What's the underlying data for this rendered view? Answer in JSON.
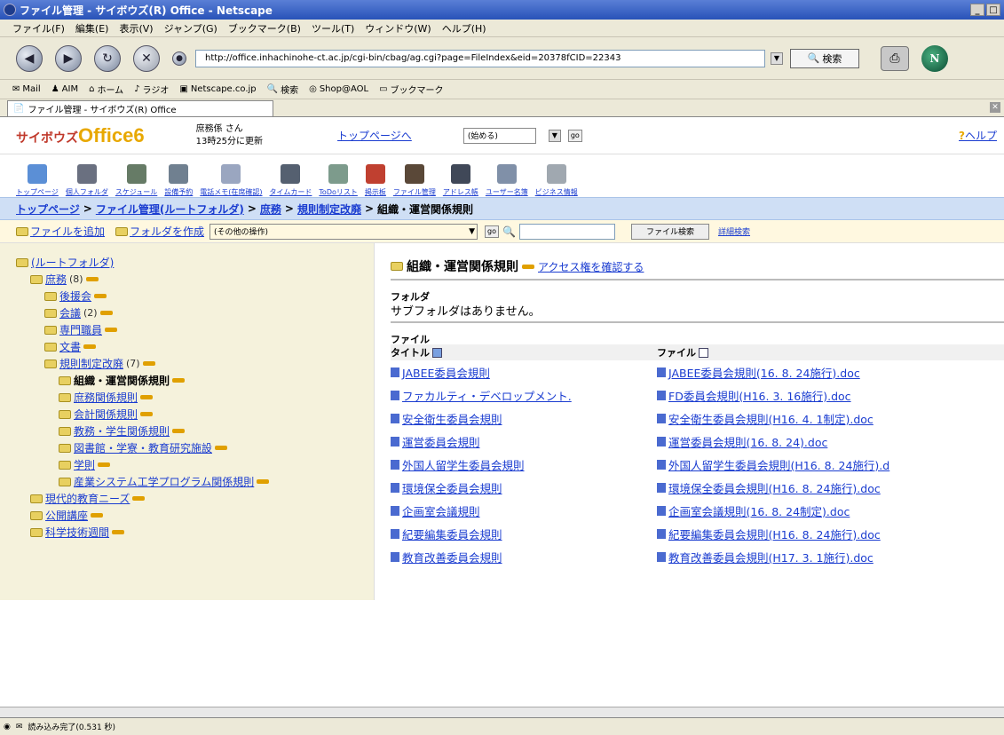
{
  "window": {
    "title": "ファイル管理 - サイボウズ(R) Office - Netscape"
  },
  "menu": [
    "ファイル(F)",
    "編集(E)",
    "表示(V)",
    "ジャンプ(G)",
    "ブックマーク(B)",
    "ツール(T)",
    "ウィンドウ(W)",
    "ヘルプ(H)"
  ],
  "nav": {
    "url": "http://office.inhachinohe-ct.ac.jp/cgi-bin/cbag/ag.cgi?page=FileIndex&eid=20378fCID=22343",
    "search": "検索"
  },
  "personal": [
    "Mail",
    "AIM",
    "ホーム",
    "ラジオ",
    "Netscape.co.jp",
    "検索",
    "Shop@AOL",
    "ブックマーク"
  ],
  "tab": {
    "label": "ファイル管理 - サイボウズ(R) Office"
  },
  "app": {
    "logo_prefix": "サイボウズ",
    "logo_name": "Office6",
    "user": "庶務係 さん",
    "updated": "13時25分に更新",
    "top_link": "トップページへ",
    "select": "(始める)",
    "go": "go",
    "help": "ヘルプ"
  },
  "apps": [
    "トップページ",
    "個人フォルダ",
    "スケジュール",
    "設備予約",
    "電話メモ(在席確認)",
    "タイムカード",
    "ToDoリスト",
    "掲示板",
    "ファイル管理",
    "アドレス帳",
    "ユーザー名簿",
    "ビジネス情報"
  ],
  "breadcrumb": [
    "トップページ",
    "ファイル管理(ルートフォルダ)",
    "庶務",
    "規則制定改廃",
    "組織・運営関係規則"
  ],
  "actions": {
    "add_file": "ファイルを追加",
    "make_folder": "フォルダを作成",
    "other_ops": "(その他の操作)",
    "file_search": "ファイル検索",
    "detail_search": "詳細検索"
  },
  "tree": [
    {
      "label": "(ルートフォルダ)",
      "count": "",
      "indent": 0
    },
    {
      "label": "庶務",
      "count": "(8)",
      "indent": 1
    },
    {
      "label": "後援会",
      "count": "",
      "indent": 2
    },
    {
      "label": "会議",
      "count": "(2)",
      "indent": 2
    },
    {
      "label": "専門職員",
      "count": "",
      "indent": 2
    },
    {
      "label": "文書",
      "count": "",
      "indent": 2
    },
    {
      "label": "規則制定改廃",
      "count": "(7)",
      "indent": 2
    },
    {
      "label": "組織・運営関係規則",
      "count": "",
      "indent": 3
    },
    {
      "label": "庶務関係規則",
      "count": "",
      "indent": 3
    },
    {
      "label": "会計関係規則",
      "count": "",
      "indent": 3
    },
    {
      "label": "教務・学生関係規則",
      "count": "",
      "indent": 3
    },
    {
      "label": "図書館・学寮・教育研究施設",
      "count": "",
      "indent": 3
    },
    {
      "label": "学則",
      "count": "",
      "indent": 3
    },
    {
      "label": "産業システム工学プログラム関係規則",
      "count": "",
      "indent": 3
    },
    {
      "label": "現代的教育ニーズ",
      "count": "",
      "indent": 1
    },
    {
      "label": "公開講座",
      "count": "",
      "indent": 1
    },
    {
      "label": "科学技術週間",
      "count": "",
      "indent": 1
    }
  ],
  "content": {
    "title": "組織・運営関係規則",
    "access_link": "アクセス権を確認する",
    "folder_section": "フォルダ",
    "no_subfolder": "サブフォルダはありません。",
    "file_section": "ファイル",
    "col_title": "タイトル",
    "col_file": "ファイル"
  },
  "files": [
    {
      "title": "JABEE委員会規則",
      "file": "JABEE委員会規則(16. 8. 24施行).doc"
    },
    {
      "title": "ファカルティ・デベロップメント.",
      "file": "FD委員会規則(H16. 3. 16施行).doc"
    },
    {
      "title": "安全衛生委員会規則",
      "file": "安全衛生委員会規則(H16. 4. 1制定).doc"
    },
    {
      "title": "運営委員会規則",
      "file": "運営委員会規則(16. 8. 24).doc"
    },
    {
      "title": "外国人留学生委員会規則",
      "file": "外国人留学生委員会規則(H16. 8. 24施行).d"
    },
    {
      "title": "環境保全委員会規則",
      "file": "環境保全委員会規則(H16. 8. 24施行).doc"
    },
    {
      "title": "企画室会議規則",
      "file": "企画室会議規則(16. 8. 24制定).doc"
    },
    {
      "title": "紀要編集委員会規則",
      "file": "紀要編集委員会規則(H16. 8. 24施行).doc"
    },
    {
      "title": "教育改善委員会規則",
      "file": "教育改善委員会規則(H17. 3. 1施行).doc"
    }
  ],
  "status": {
    "text": "読み込み完了(0.531 秒)"
  }
}
